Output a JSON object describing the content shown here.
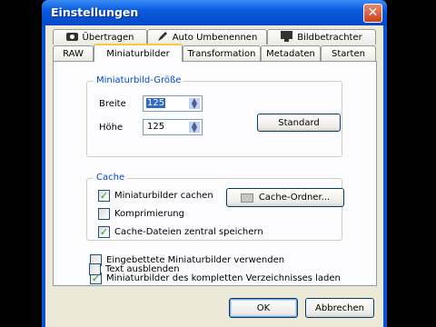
{
  "window": {
    "title": "Einstellungen",
    "close_glyph": "✕"
  },
  "tabs_top": [
    {
      "label": "Übertragen",
      "icon": "camera-icon"
    },
    {
      "label": "Auto Umbenennen",
      "icon": "pen-icon"
    },
    {
      "label": "Bildbetrachter",
      "icon": "monitor-icon"
    }
  ],
  "tabs_bottom": [
    {
      "label": "RAW"
    },
    {
      "label": "Miniaturbilder"
    },
    {
      "label": "Transformation"
    },
    {
      "label": "Metadaten"
    },
    {
      "label": "Starten"
    }
  ],
  "size_group": {
    "legend": "Miniaturbild-Größe",
    "width_label": "Breite",
    "width_value": "125",
    "height_label": "Höhe",
    "height_value": "125",
    "standard_label": "Standard"
  },
  "cache_group": {
    "legend": "Cache",
    "cache_folder_label": "Cache-Ordner...",
    "options": [
      {
        "label": "Miniaturbilder cachen",
        "checked": true
      },
      {
        "label": "Komprimierung",
        "checked": false
      },
      {
        "label": "Cache-Dateien zentral speichern",
        "checked": true
      }
    ]
  },
  "extra_options": [
    {
      "label": "Eingebettete Miniaturbilder verwenden",
      "checked": false
    },
    {
      "label": "Miniaturbilder des kompletten Verzeichnisses laden",
      "checked": true
    },
    {
      "label": "Text ausblenden",
      "checked": false
    }
  ],
  "footer": {
    "ok_label": "OK",
    "cancel_label": "Abbrechen"
  },
  "colors": {
    "titlebar": "#0a53d6",
    "accent": "#0046d5",
    "dialog_bg": "#ece9d8",
    "check": "#21a121"
  }
}
